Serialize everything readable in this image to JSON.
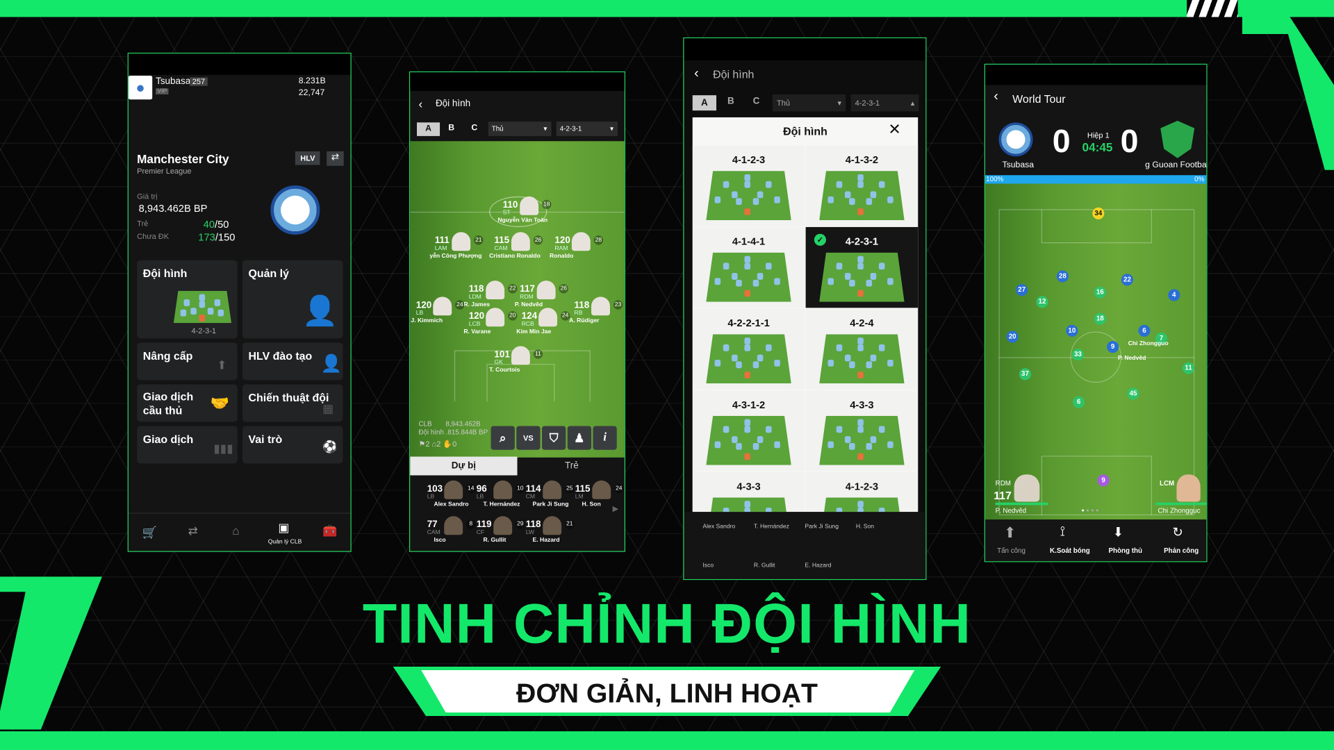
{
  "colors": {
    "accent": "#14e86a",
    "blue_team": "#2a6fd6",
    "green_team": "#2fc36a"
  },
  "panel1": {
    "user": "Tsubasa",
    "level": "257",
    "vip": "VIP",
    "currency1": "8.231B",
    "currency2": "22,747",
    "club": "Manchester City",
    "league": "Premier League",
    "hlv": "HLV",
    "value_label": "Giá trị",
    "value": "8,943.462B BP",
    "youth_label": "Trẻ",
    "youth_cur": "40",
    "youth_max": "/50",
    "unreg_label": "Chưa ĐK",
    "unreg_cur": "173",
    "unreg_max": "/150",
    "tiles": [
      {
        "label": "Đội hình",
        "sub": "4-2-3-1"
      },
      {
        "label": "Quản lý"
      },
      {
        "label": "Nâng cấp"
      },
      {
        "label": "HLV đào tạo"
      },
      {
        "label": "Giao dịch cầu thủ"
      },
      {
        "label": "Chiến thuật đội"
      },
      {
        "label": "Giao dịch"
      },
      {
        "label": "Vai trò"
      }
    ],
    "nav": {
      "active": "Quản lý CLB"
    }
  },
  "panel2": {
    "title": "Đội hình",
    "tabs": [
      "A",
      "B",
      "C"
    ],
    "select1": "Thủ",
    "select2": "4-2-3-1",
    "players": [
      {
        "r": "110",
        "p": "ST",
        "n": "Nguyễn Văn Toàn",
        "lv": "18"
      },
      {
        "r": "111",
        "p": "LAM",
        "n": "yễn Công Phượng",
        "lv": "21"
      },
      {
        "r": "115",
        "p": "CAM",
        "n": "Cristiano Ronaldo",
        "lv": "26"
      },
      {
        "r": "120",
        "p": "RAM",
        "n": "Ronaldo",
        "lv": "28"
      },
      {
        "r": "118",
        "p": "LDM",
        "n": "R. James",
        "lv": "22"
      },
      {
        "r": "117",
        "p": "RDM",
        "n": "P. Nedvěd",
        "lv": "26"
      },
      {
        "r": "120",
        "p": "LB",
        "n": "J. Kimmich",
        "lv": "24"
      },
      {
        "r": "120",
        "p": "LCB",
        "n": "R. Varane",
        "lv": "20"
      },
      {
        "r": "124",
        "p": "RCB",
        "n": "Kim Min Jae",
        "lv": "24"
      },
      {
        "r": "118",
        "p": "RB",
        "n": "A. Rüdiger",
        "lv": "23"
      },
      {
        "r": "101",
        "p": "GK",
        "n": "T. Courtois",
        "lv": "11"
      }
    ],
    "club_label": "CLB",
    "club_value": "8,943.462B",
    "squad_label": "Đội hình",
    "squad_value": ".815.844B BP",
    "counts": [
      "2",
      "2",
      "0"
    ],
    "sub_tabs": [
      "Dự bị",
      "Trẻ"
    ],
    "bench": [
      {
        "r": "103",
        "p": "LB",
        "n": "Alex Sandro",
        "lv": "14"
      },
      {
        "r": "96",
        "p": "LB",
        "n": "T. Hernández",
        "lv": "10"
      },
      {
        "r": "114",
        "p": "CM",
        "n": "Park Ji Sung",
        "lv": "25"
      },
      {
        "r": "115",
        "p": "LM",
        "n": "H. Son",
        "lv": "24"
      },
      {
        "r": "77",
        "p": "CAM",
        "n": "Isco",
        "lv": "8"
      },
      {
        "r": "119",
        "p": "CF",
        "n": "R. Gullit",
        "lv": "29"
      },
      {
        "r": "118",
        "p": "LW",
        "n": "E. Hazard",
        "lv": "21"
      }
    ]
  },
  "panel3": {
    "title": "Đội hình",
    "tabs": [
      "A",
      "B",
      "C"
    ],
    "select1": "Thủ",
    "select2": "4-2-3-1",
    "modal_title": "Đội hình",
    "formations": [
      {
        "name": "4-1-2-3",
        "recommended": true
      },
      {
        "name": "4-1-3-2"
      },
      {
        "name": "4-1-4-1"
      },
      {
        "name": "4-2-3-1",
        "selected": true
      },
      {
        "name": "4-2-2-1-1"
      },
      {
        "name": "4-2-4"
      },
      {
        "name": "4-3-1-2"
      },
      {
        "name": "4-3-3"
      },
      {
        "name": "4-3-3"
      },
      {
        "name": "4-1-2-3",
        "recommended": true
      }
    ],
    "bench_names": [
      "Alex Sandro",
      "T. Hernández",
      "Park Ji Sung",
      "H. Son",
      "Isco",
      "R. Gullit",
      "E. Hazard"
    ]
  },
  "panel4": {
    "title": "World Tour",
    "home": "Tsubasa",
    "away": "g Guoan Football C",
    "score_home": "0",
    "score_away": "0",
    "half": "Hiệp 1",
    "clock": "04:45",
    "poss_home": "100%",
    "poss_away": "0%",
    "dots": [
      {
        "n": "34",
        "c": "yellow"
      },
      {
        "n": "27",
        "c": "blue"
      },
      {
        "n": "28",
        "c": "blue"
      },
      {
        "n": "22",
        "c": "blue"
      },
      {
        "n": "4",
        "c": "blue"
      },
      {
        "n": "20",
        "c": "blue"
      },
      {
        "n": "10",
        "c": "blue"
      },
      {
        "n": "9",
        "c": "blue"
      },
      {
        "n": "6",
        "c": "blue"
      },
      {
        "n": "12",
        "c": "green"
      },
      {
        "n": "16",
        "c": "green"
      },
      {
        "n": "18",
        "c": "green"
      },
      {
        "n": "7",
        "c": "green"
      },
      {
        "n": "33",
        "c": "green"
      },
      {
        "n": "11",
        "c": "green"
      },
      {
        "n": "37",
        "c": "green"
      },
      {
        "n": "6",
        "c": "green"
      },
      {
        "n": "45",
        "c": "green"
      },
      {
        "n": "9",
        "c": "purple"
      }
    ],
    "tag1": "Chi Zhongguo",
    "tag2": "P. Nedvěd",
    "left_card": {
      "pos": "RDM",
      "rating": "117",
      "name": "P. Nedvěd"
    },
    "right_card": {
      "pos": "LCM",
      "name": "Chi Zhongguc"
    },
    "tactics": [
      "Tấn công",
      "K.Soát bóng",
      "Phòng thủ",
      "Phản công"
    ]
  },
  "headline": "TINH CHỈNH ĐỘI HÌNH",
  "subheadline": "ĐƠN GIẢN, LINH HOẠT"
}
